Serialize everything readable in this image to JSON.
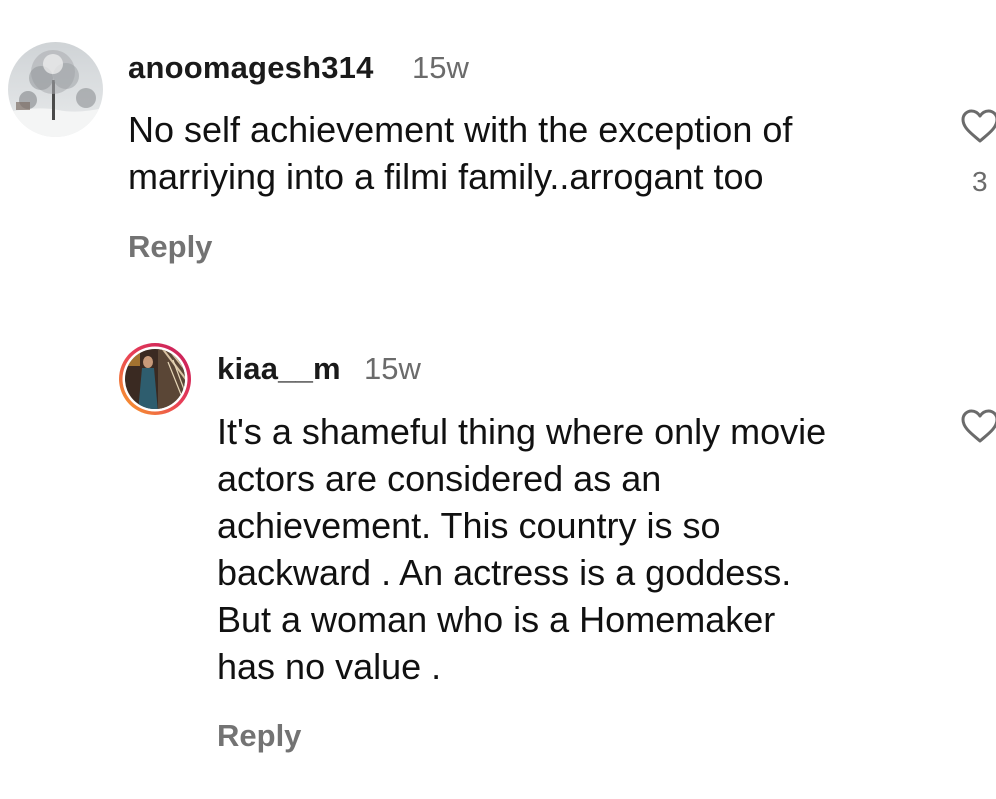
{
  "comments": [
    {
      "username": "anoomagesh314",
      "timestamp": "15w",
      "text": "No self achievement with the exception of\nmarriying into a filmi family..arrogant too",
      "reply_label": "Reply",
      "like_count": "3",
      "avatar_icon": "snowy-tree-photo"
    },
    {
      "username": "kiaa__m",
      "timestamp": "15w",
      "text": "It's a shameful thing where only movie\nactors are considered as an\nachievement.  This country is so\nbackward . An actress is a goddess.\nBut a woman who is a Homemaker\nhas no value .",
      "reply_label": "Reply",
      "avatar_icon": "person-photo-story-ring"
    }
  ],
  "colors": {
    "text": "#111111",
    "muted": "#737373",
    "story_ring_start": "#f9a825",
    "story_ring_end": "#c2185b"
  }
}
